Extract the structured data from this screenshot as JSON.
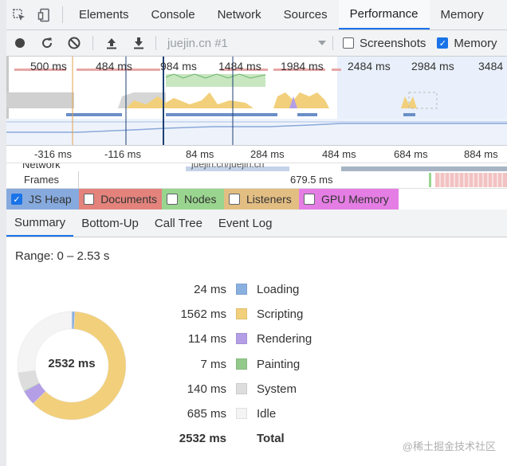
{
  "tabs": [
    {
      "label": "Elements",
      "active": false
    },
    {
      "label": "Console",
      "active": false
    },
    {
      "label": "Network",
      "active": false
    },
    {
      "label": "Sources",
      "active": false
    },
    {
      "label": "Performance",
      "active": true
    },
    {
      "label": "Memory",
      "active": false
    }
  ],
  "toolbar": {
    "profile_label": "juejin.cn #1",
    "screenshots_label": "Screenshots",
    "screenshots_checked": false,
    "memory_label": "Memory",
    "memory_checked": true
  },
  "overview": {
    "labels": [
      "500 ms",
      "484 ms",
      "984 ms",
      "1484 ms",
      "1984 ms",
      "2484 ms",
      "2984 ms",
      "3484"
    ]
  },
  "ruler": {
    "labels": [
      "-316 ms",
      "-116 ms",
      "84 ms",
      "284 ms",
      "484 ms",
      "684 ms",
      "884 ms"
    ]
  },
  "tracks": {
    "network_label": "Network",
    "network_item": "juejin.cn/juejin.cn",
    "frames_label": "Frames",
    "frame_time": "679.5 ms"
  },
  "counters": [
    {
      "label": "JS Heap",
      "checked": true,
      "color": "#87aade"
    },
    {
      "label": "Documents",
      "checked": false,
      "color": "#e3837c"
    },
    {
      "label": "Nodes",
      "checked": false,
      "color": "#9ad58f"
    },
    {
      "label": "Listeners",
      "checked": false,
      "color": "#e3be83"
    },
    {
      "label": "GPU Memory",
      "checked": false,
      "color": "#e57ee4"
    }
  ],
  "subtabs": [
    {
      "label": "Summary",
      "active": true
    },
    {
      "label": "Bottom-Up",
      "active": false
    },
    {
      "label": "Call Tree",
      "active": false
    },
    {
      "label": "Event Log",
      "active": false
    }
  ],
  "summary": {
    "range": "Range: 0 – 2.53 s",
    "total_label": "2532 ms",
    "legend": [
      {
        "value": "24 ms",
        "name": "Loading",
        "color": "#8ab0e0"
      },
      {
        "value": "1562 ms",
        "name": "Scripting",
        "color": "#f2cf7a"
      },
      {
        "value": "114 ms",
        "name": "Rendering",
        "color": "#b49ee6"
      },
      {
        "value": "7 ms",
        "name": "Painting",
        "color": "#93c98a"
      },
      {
        "value": "140 ms",
        "name": "System",
        "color": "#dddddd"
      },
      {
        "value": "685 ms",
        "name": "Idle",
        "color": "#f4f4f4"
      },
      {
        "value": "2532 ms",
        "name": "Total",
        "color": ""
      }
    ],
    "breakdown_ms": [
      24,
      1562,
      114,
      7,
      140,
      685
    ]
  },
  "watermark": "@稀土掘金技术社区"
}
